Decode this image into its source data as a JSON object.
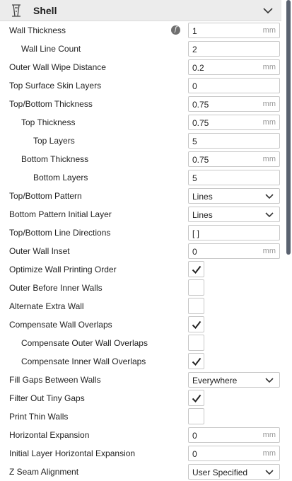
{
  "section": {
    "title": "Shell",
    "icon": "shell-icon",
    "collapse_icon": "chevron-down-icon"
  },
  "settings": [
    {
      "name": "wall-thickness",
      "label": "Wall Thickness",
      "type": "number",
      "value": "1",
      "unit": "mm",
      "indent": 0,
      "has_function_icon": true
    },
    {
      "name": "wall-line-count",
      "label": "Wall Line Count",
      "type": "number",
      "value": "2",
      "unit": "",
      "indent": 1
    },
    {
      "name": "outer-wall-wipe-distance",
      "label": "Outer Wall Wipe Distance",
      "type": "number",
      "value": "0.2",
      "unit": "mm",
      "indent": 0
    },
    {
      "name": "top-surface-skin-layers",
      "label": "Top Surface Skin Layers",
      "type": "number",
      "value": "0",
      "unit": "",
      "indent": 0
    },
    {
      "name": "top-bottom-thickness",
      "label": "Top/Bottom Thickness",
      "type": "number",
      "value": "0.75",
      "unit": "mm",
      "indent": 0
    },
    {
      "name": "top-thickness",
      "label": "Top Thickness",
      "type": "number",
      "value": "0.75",
      "unit": "mm",
      "indent": 1
    },
    {
      "name": "top-layers",
      "label": "Top Layers",
      "type": "number",
      "value": "5",
      "unit": "",
      "indent": 2
    },
    {
      "name": "bottom-thickness",
      "label": "Bottom Thickness",
      "type": "number",
      "value": "0.75",
      "unit": "mm",
      "indent": 1
    },
    {
      "name": "bottom-layers",
      "label": "Bottom Layers",
      "type": "number",
      "value": "5",
      "unit": "",
      "indent": 2
    },
    {
      "name": "top-bottom-pattern",
      "label": "Top/Bottom Pattern",
      "type": "select",
      "value": "Lines",
      "indent": 0
    },
    {
      "name": "bottom-pattern-initial-layer",
      "label": "Bottom Pattern Initial Layer",
      "type": "select",
      "value": "Lines",
      "indent": 0
    },
    {
      "name": "top-bottom-line-directions",
      "label": "Top/Bottom Line Directions",
      "type": "text",
      "value": "[ ]",
      "unit": "",
      "indent": 0
    },
    {
      "name": "outer-wall-inset",
      "label": "Outer Wall Inset",
      "type": "number",
      "value": "0",
      "unit": "mm",
      "indent": 0
    },
    {
      "name": "optimize-wall-printing-order",
      "label": "Optimize Wall Printing Order",
      "type": "checkbox",
      "checked": true,
      "indent": 0
    },
    {
      "name": "outer-before-inner-walls",
      "label": "Outer Before Inner Walls",
      "type": "checkbox",
      "checked": false,
      "indent": 0
    },
    {
      "name": "alternate-extra-wall",
      "label": "Alternate Extra Wall",
      "type": "checkbox",
      "checked": false,
      "indent": 0
    },
    {
      "name": "compensate-wall-overlaps",
      "label": "Compensate Wall Overlaps",
      "type": "checkbox",
      "checked": true,
      "indent": 0
    },
    {
      "name": "compensate-outer-wall-overlaps",
      "label": "Compensate Outer Wall Overlaps",
      "type": "checkbox",
      "checked": false,
      "indent": 1
    },
    {
      "name": "compensate-inner-wall-overlaps",
      "label": "Compensate Inner Wall Overlaps",
      "type": "checkbox",
      "checked": true,
      "indent": 1
    },
    {
      "name": "fill-gaps-between-walls",
      "label": "Fill Gaps Between Walls",
      "type": "select",
      "value": "Everywhere",
      "indent": 0
    },
    {
      "name": "filter-out-tiny-gaps",
      "label": "Filter Out Tiny Gaps",
      "type": "checkbox",
      "checked": true,
      "indent": 0
    },
    {
      "name": "print-thin-walls",
      "label": "Print Thin Walls",
      "type": "checkbox",
      "checked": false,
      "indent": 0
    },
    {
      "name": "horizontal-expansion",
      "label": "Horizontal Expansion",
      "type": "number",
      "value": "0",
      "unit": "mm",
      "indent": 0
    },
    {
      "name": "initial-layer-horizontal-expansion",
      "label": "Initial Layer Horizontal Expansion",
      "type": "number",
      "value": "0",
      "unit": "mm",
      "indent": 0
    },
    {
      "name": "z-seam-alignment",
      "label": "Z Seam Alignment",
      "type": "select",
      "value": "User Specified",
      "indent": 0
    }
  ]
}
